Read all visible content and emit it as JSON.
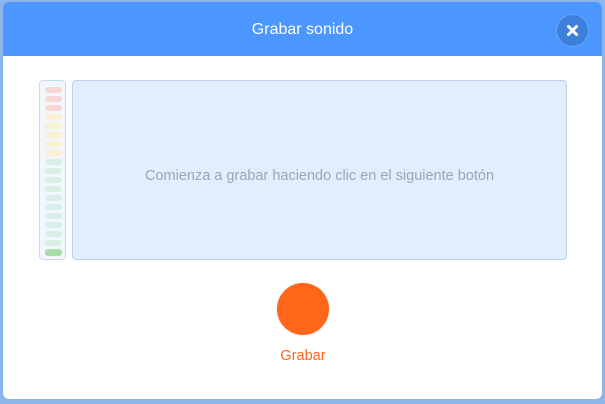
{
  "modal": {
    "title": "Grabar sonido"
  },
  "icons": {
    "close": "close-icon",
    "record": "record-icon"
  },
  "recorder": {
    "hint": "Comienza a grabar haciendo clic en el siguiente botón",
    "record_label": "Grabar"
  },
  "meter": {
    "level": 0.0
  },
  "colors": {
    "header": "#4c97ff",
    "record": "#ff661a",
    "meter_red": "#f8d6d3",
    "meter_yellow": "#fbefd4",
    "meter_green": "#d9eee4",
    "meter_active": "#a6e0a6"
  }
}
